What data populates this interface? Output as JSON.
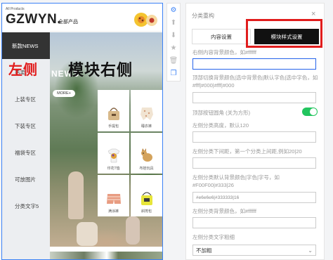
{
  "preview": {
    "all_products_small": "All Products",
    "logo": "GZWYN.",
    "all_products_cn": "全部产品",
    "sidebar": {
      "items": [
        {
          "label": "新款NEWS",
          "active": true
        },
        {
          "label": "热卖",
          "active": false
        },
        {
          "label": "上装专区",
          "active": false
        },
        {
          "label": "下装专区",
          "active": false
        },
        {
          "label": "福袋专区",
          "active": false
        },
        {
          "label": "可放图片",
          "active": false
        },
        {
          "label": "分类文字5",
          "active": false
        }
      ]
    },
    "annotation_left": "左侧",
    "annotation_right": "模块右侧",
    "banner_title": "NEWS",
    "more_button": "MORE+",
    "products": [
      {
        "label": "手提包",
        "icon": "handbag-icon"
      },
      {
        "label": "睡衣裤",
        "icon": "pajama-icon"
      },
      {
        "label": "印花T恤",
        "icon": "tshirt-icon"
      },
      {
        "label": "布娃玩具",
        "icon": "plush-toy-icon"
      },
      {
        "label": "满涂裤",
        "icon": "shorts-icon"
      },
      {
        "label": "斜挎包",
        "icon": "crossbody-bag-icon"
      }
    ]
  },
  "toolbar": {
    "tools": [
      {
        "name": "gear-icon",
        "active": true
      },
      {
        "name": "arrow-up-icon",
        "active": false
      },
      {
        "name": "arrow-down-icon",
        "active": false
      },
      {
        "name": "star-icon",
        "active": false
      },
      {
        "name": "trash-icon",
        "active": false
      },
      {
        "name": "copy-icon",
        "active": true
      }
    ]
  },
  "panel": {
    "title": "分类重构",
    "close": "×",
    "tabs": {
      "content": "内容设置",
      "style": "模块样式设置"
    },
    "fields": {
      "right_bg_label": "右侧内容背景颜色，如#ffffff",
      "right_bg_value": "",
      "top_switch_label": "顶部切换背景颜色|选中背景色|默认字色|选中字色，如#fff|#000|#fff|#000",
      "top_switch_value": "",
      "top_rounded_label": "顶部按钮圆角 (关为方形)",
      "top_rounded_on": true,
      "left_height_label": "左侧分类高度，默认120",
      "left_height_value": "",
      "left_margin_label": "左侧分类下间距，第一个分类上间距,例如20|20",
      "left_margin_value": "",
      "left_default_label": "左侧分类默认背景颜色|字色|字号，如#F00F00|#333|26",
      "left_default_value": "#e6e6e6|#333333|16",
      "left_bg_label": "左侧分类背景颜色，如#ffffff",
      "left_bg_value": "",
      "left_bold_label": "左侧分类文字粗细",
      "left_bold_value": "不加粗"
    }
  },
  "colors": {
    "accent": "#3b82f6",
    "toggle_on": "#22c55e",
    "highlight": "#e11d1d"
  }
}
